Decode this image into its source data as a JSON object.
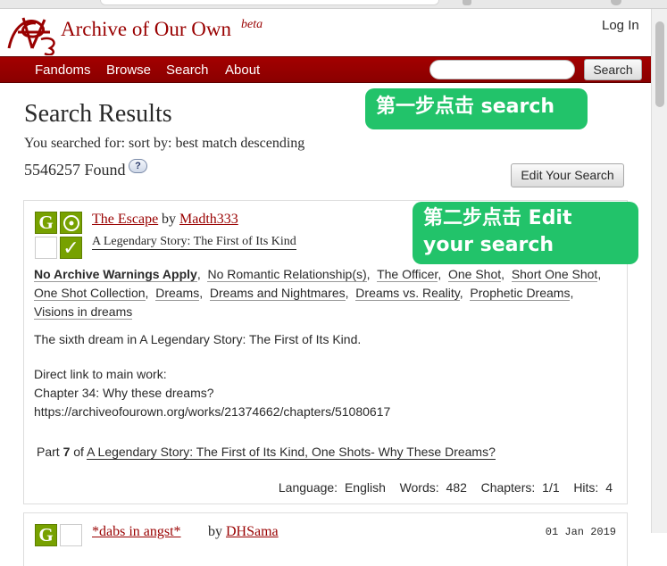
{
  "header": {
    "site_title": "Archive of Our Own",
    "site_beta": "beta",
    "login": "Log In"
  },
  "nav": {
    "items": [
      {
        "label": "Fandoms"
      },
      {
        "label": "Browse"
      },
      {
        "label": "Search"
      },
      {
        "label": "About"
      }
    ],
    "search_value": "",
    "search_button": "Search"
  },
  "main": {
    "title": "Search Results",
    "searched_for": "You searched for: sort by: best match descending",
    "found": "5546257 Found",
    "help": "?",
    "edit_search": "Edit Your Search"
  },
  "work1": {
    "rating_letter": "G",
    "complete_mark": "✓",
    "title": "The Escape",
    "by": "by",
    "author": "Madth333",
    "fandom": "A Legendary Story: The First of Its Kind",
    "tags": [
      "No Archive Warnings Apply",
      "No Romantic Relationship(s)",
      "The Officer",
      "One Shot",
      "Short One Shot",
      "One Shot Collection",
      "Dreams",
      "Dreams and Nightmares",
      "Dreams vs. Reality",
      "Prophetic Dreams",
      "Visions in dreams"
    ],
    "summary_1": "The sixth dream in A Legendary Story: The First of Its Kind.",
    "summary_2_line1": "Direct link to main work:",
    "summary_2_line2": "Chapter 34: Why these dreams?",
    "summary_2_line3": "https://archiveofourown.org/works/21374662/chapters/51080617",
    "series_part_label": "Part",
    "series_part_num": "7",
    "series_of": "of",
    "series_title": "A Legendary Story: The First of Its Kind, One Shots- Why These Dreams?",
    "stats": {
      "language_label": "Language:",
      "language": "English",
      "words_label": "Words:",
      "words": "482",
      "chapters_label": "Chapters:",
      "chapters": "1/1",
      "hits_label": "Hits:",
      "hits": "4"
    }
  },
  "work2": {
    "rating_letter": "G",
    "title": "*dabs in angst*",
    "by": "by",
    "author": "DHSama",
    "date": "01 Jan 2019"
  },
  "annotations": {
    "step1": "第一步点击 search",
    "step2": "第二步点击 Edit your search"
  },
  "colors": {
    "brand_red": "#990000",
    "nav_red": "#a30000",
    "rating_green": "#77a100",
    "callout_green": "#22c36a"
  }
}
